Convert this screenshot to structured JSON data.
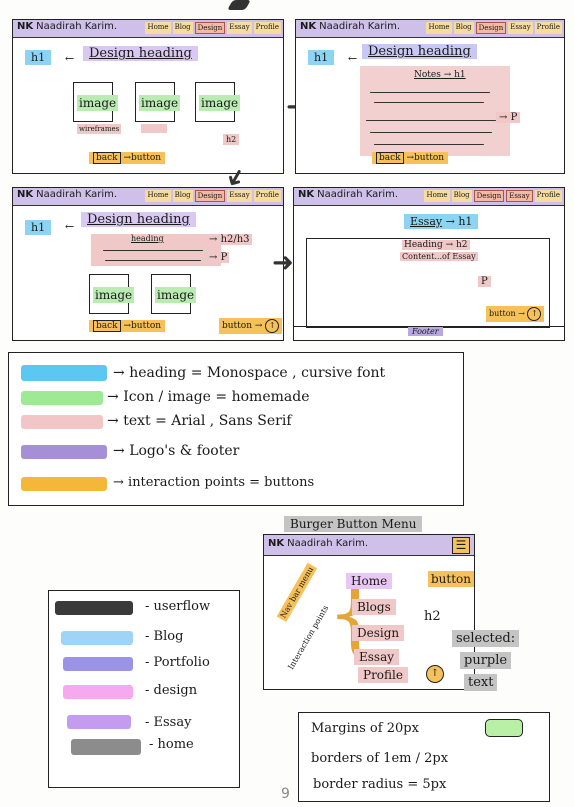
{
  "nav": {
    "logo_mark": "NK",
    "logo_name": "Naadirah Karim.",
    "links": [
      "Home",
      "Blog",
      "Design",
      "Essay",
      "Profile"
    ]
  },
  "frame1": {
    "h1_tag": "h1",
    "design_heading": "Design heading",
    "image_label": "image",
    "wireframes_label": "wireframes",
    "h2_label": "h2",
    "back_label": "back",
    "button_label": "button"
  },
  "frame2": {
    "h1_tag": "h1",
    "design_heading": "Design heading",
    "notes_label": "Notes",
    "notes_h1": "h1",
    "p_label": "P",
    "back_label": "back",
    "button_label": "button"
  },
  "frame3": {
    "h1_tag": "h1",
    "design_heading": "Design heading",
    "heading_label": "heading",
    "h2h3_label": "h2/h3",
    "p_label": "P",
    "image_label": "image",
    "back_label": "back",
    "button_label": "button",
    "button_right_label": "button"
  },
  "frame4": {
    "essay_label": "Essay",
    "h1_tag": "h1",
    "heading_label": "Heading",
    "h2_label": "h2",
    "content_label": "Content...of Essay",
    "p_label": "P",
    "button_label": "button",
    "footer_label": "Footer"
  },
  "legend": {
    "items": [
      {
        "text": "heading = Monospace , cursive font",
        "color": "#5cc8f2"
      },
      {
        "text": "Icon / image = homemade",
        "color": "#9eea94"
      },
      {
        "text": "text = Arial , Sans Serif",
        "color": "#f2c6c6"
      },
      {
        "text": "Logo's & footer",
        "color": "#a58fd6"
      },
      {
        "text": "interaction points = buttons",
        "color": "#f5b73a"
      }
    ]
  },
  "burger": {
    "title": "Burger Button Menu",
    "nav_bar_menu": "Nav bar menu",
    "interaction_points": "Interaction points",
    "items": [
      "Home",
      "Blogs",
      "Design",
      "Essay",
      "Profile"
    ],
    "button_label": "button",
    "h2_label": "h2",
    "selected_label": "selected:",
    "purple_label": "purple",
    "text_label": "text"
  },
  "userflow": {
    "items": [
      {
        "label": "- userflow",
        "color": "#3a3a3a"
      },
      {
        "label": "- Blog",
        "color": "#9fd4f7"
      },
      {
        "label": "- Portfolio",
        "color": "#9b93e6"
      },
      {
        "label": "- design",
        "color": "#f7a9ef"
      },
      {
        "label": "- Essay",
        "color": "#c39bf0"
      },
      {
        "label": "- home",
        "color": "#8c8c8c"
      }
    ]
  },
  "specs": {
    "line1": "Margins of 20px",
    "line2": "borders of 1em / 2px",
    "line3": "border radius = 5px"
  },
  "page_number": "9"
}
